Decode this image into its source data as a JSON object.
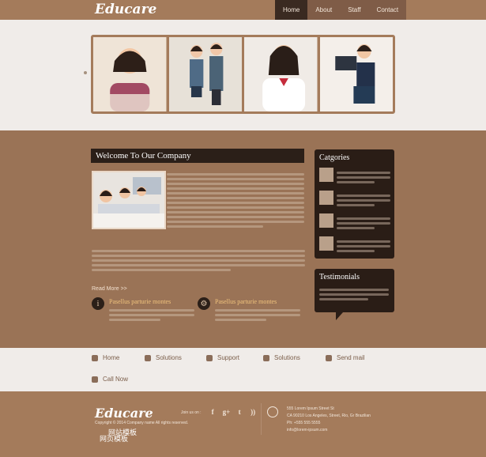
{
  "header": {
    "logo": "Educare",
    "nav": [
      "Home",
      "About",
      "Staff",
      "Contact"
    ]
  },
  "welcome": {
    "title": "Welcome To Our Company",
    "read_more": "Read More >>"
  },
  "features": [
    {
      "title": "Pasellus parturie montes",
      "icon": "info"
    },
    {
      "title": "Pasellus parturie montes",
      "icon": "gear"
    }
  ],
  "sidebar": {
    "categories_title": "Catgories",
    "testimonials_title": "Testimonials"
  },
  "links": [
    "Home",
    "Solutions",
    "Support",
    "Solutions",
    "Send mail",
    "Call Now"
  ],
  "footer": {
    "logo": "Educare",
    "copyright": "Copyright © 2014 Company name All rights reserved.",
    "cn_text_1": "网站模板",
    "cn_text_2": "网页模板",
    "social_label": "Join us on :",
    "contact_lines": [
      "555 Lorem Ipsum Street St",
      "CA 90210 Los Angeles, Street, Rio, Gr Brazilian",
      "Ph: +555 555 5555",
      "info@lorem-ipsum.com"
    ]
  }
}
